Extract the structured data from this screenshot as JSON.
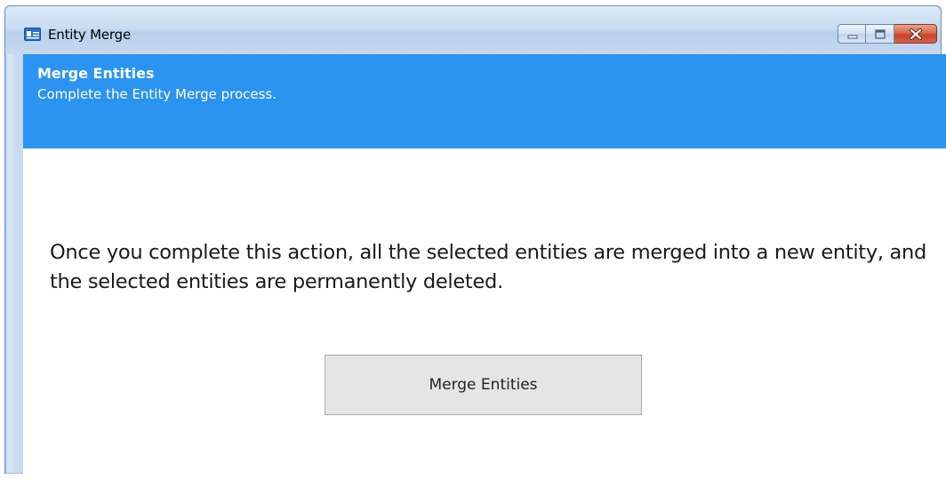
{
  "window": {
    "title": "Entity Merge",
    "icon": "contact-card-icon",
    "controls": {
      "minimize_icon": "minimize-icon",
      "maximize_icon": "maximize-icon",
      "close_icon": "close-icon"
    }
  },
  "banner": {
    "title": "Merge Entities",
    "subtitle": "Complete the Entity Merge process.",
    "color": "#2b93f0"
  },
  "main": {
    "message": "Once you complete this action, all the selected entities are merged into a new entity, and the selected entities are permanently deleted.",
    "merge_button_label": "Merge Entities"
  },
  "colors": {
    "close_button": "#c8422a",
    "button_bg": "#e5e5e5"
  }
}
